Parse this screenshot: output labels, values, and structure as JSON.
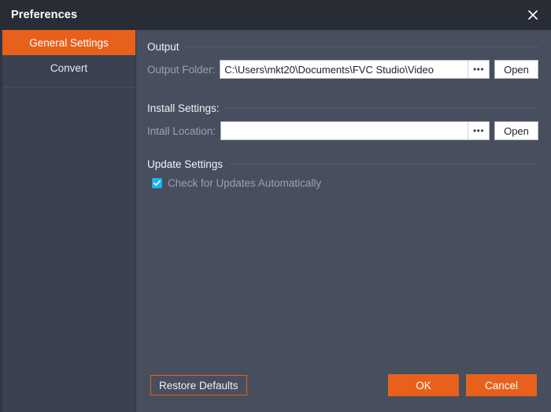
{
  "window": {
    "title": "Preferences",
    "close_icon": "close-icon"
  },
  "sidebar": {
    "items": [
      {
        "label": "General Settings",
        "active": true
      },
      {
        "label": "Convert",
        "active": false
      }
    ]
  },
  "main": {
    "sections": [
      {
        "title": "Output",
        "fields": [
          {
            "label": "Output Folder:",
            "value": "C:\\Users\\mkt20\\Documents\\FVC Studio\\Video",
            "placeholder": "",
            "browse_label": "•••",
            "open_label": "Open"
          }
        ]
      },
      {
        "title": "Install Settings:",
        "fields": [
          {
            "label": "Intall Location:",
            "value": "",
            "placeholder": "",
            "browse_label": "•••",
            "open_label": "Open"
          }
        ]
      },
      {
        "title": "Update Settings",
        "checkbox": {
          "label": "Check for Updates Automatically",
          "checked": true
        }
      }
    ]
  },
  "footer": {
    "restore_label": "Restore Defaults",
    "ok_label": "OK",
    "cancel_label": "Cancel"
  },
  "colors": {
    "accent": "#e8611c",
    "titlebar": "#272c35",
    "sidebar": "#3a4150",
    "content": "#474e5d",
    "checkbox": "#18b6ef",
    "label_text": "#9aa1ad"
  }
}
